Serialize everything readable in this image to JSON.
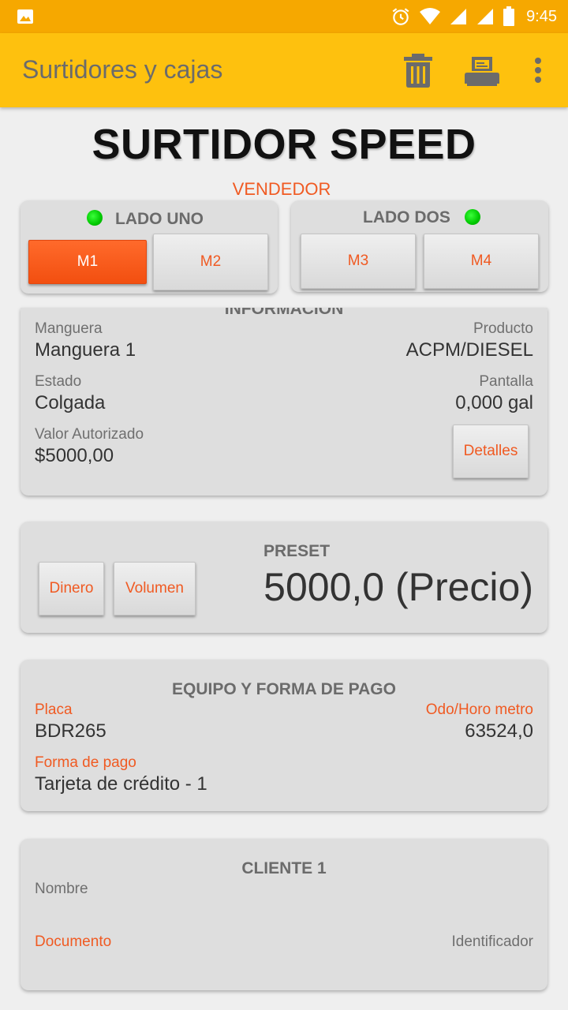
{
  "status_bar": {
    "time": "9:45"
  },
  "app_bar": {
    "title": "Surtidores y cajas",
    "icons": [
      "trash-icon",
      "printer-icon",
      "more-vert-icon"
    ]
  },
  "header": {
    "title": "SURTIDOR SPEED",
    "subtitle": "VENDEDOR"
  },
  "lados": [
    {
      "title": "LADO UNO",
      "buttons": [
        "M1",
        "M2"
      ],
      "active": "M1"
    },
    {
      "title": "LADO DOS",
      "buttons": [
        "M3",
        "M4"
      ]
    }
  ],
  "informacion": {
    "title": "INFORMACIÓN",
    "manguera_label": "Manguera",
    "manguera_value": "Manguera 1",
    "producto_label": "Producto",
    "producto_value": "ACPM/DIESEL",
    "estado_label": "Estado",
    "estado_value": "Colgada",
    "pantalla_label": "Pantalla",
    "pantalla_value": "0,000 gal",
    "valor_label": "Valor Autorizado",
    "valor_value": "$5000,00",
    "detalles_button": "Detalles"
  },
  "preset": {
    "title": "PRESET",
    "dinero_button": "Dinero",
    "volumen_button": "Volumen",
    "value": "5000,0 (Precio)"
  },
  "equipo": {
    "title": "EQUIPO Y FORMA DE PAGO",
    "placa_label": "Placa",
    "placa_value": "BDR265",
    "odo_label": "Odo/Horo metro",
    "odo_value": "63524,0",
    "forma_label": "Forma de pago",
    "forma_value": "Tarjeta de crédito - 1"
  },
  "cliente": {
    "title": "CLIENTE 1",
    "nombre_label": "Nombre",
    "documento_label": "Documento",
    "identificador_label": "Identificador"
  },
  "colors": {
    "accent": "#f05a22",
    "app_bar": "#fec10e",
    "status_bar": "#f6a800",
    "led": "#00c800"
  }
}
